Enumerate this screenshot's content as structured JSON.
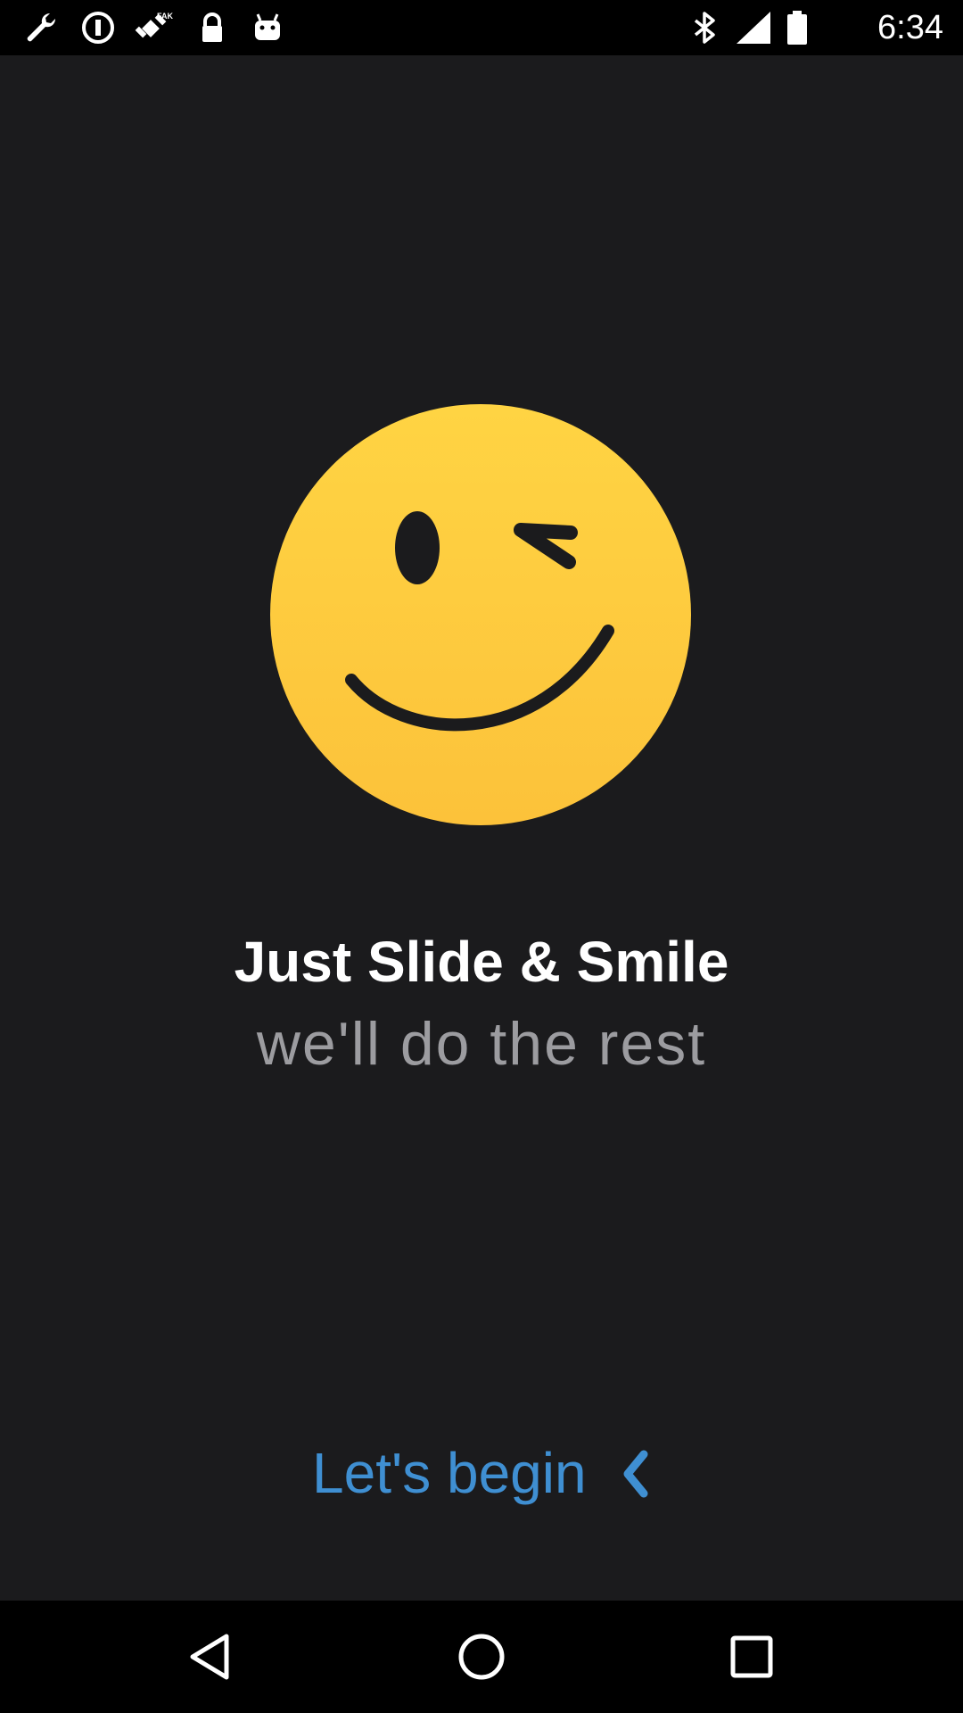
{
  "status_bar": {
    "time": "6:34",
    "left_icons": [
      "wrench-icon",
      "info-circle-icon",
      "fake-gps-icon",
      "lock-icon",
      "android-icon"
    ],
    "right_icons": [
      "bluetooth-icon",
      "signal-icon",
      "battery-icon"
    ]
  },
  "main": {
    "title": "Just Slide & Smile",
    "subtitle": "we'll do the rest",
    "begin_label": "Let's begin",
    "begin_icon": "chevron-left-icon",
    "smiley_icon": "winking-smiley-icon"
  },
  "nav_bar": {
    "back_icon": "back-triangle-icon",
    "home_icon": "home-circle-icon",
    "recents_icon": "recents-square-icon"
  },
  "colors": {
    "background": "#1b1b1d",
    "accent": "#3f8fd2",
    "smiley": "#fecd3f",
    "title": "#ffffff",
    "subtitle": "#9c9ca0"
  }
}
